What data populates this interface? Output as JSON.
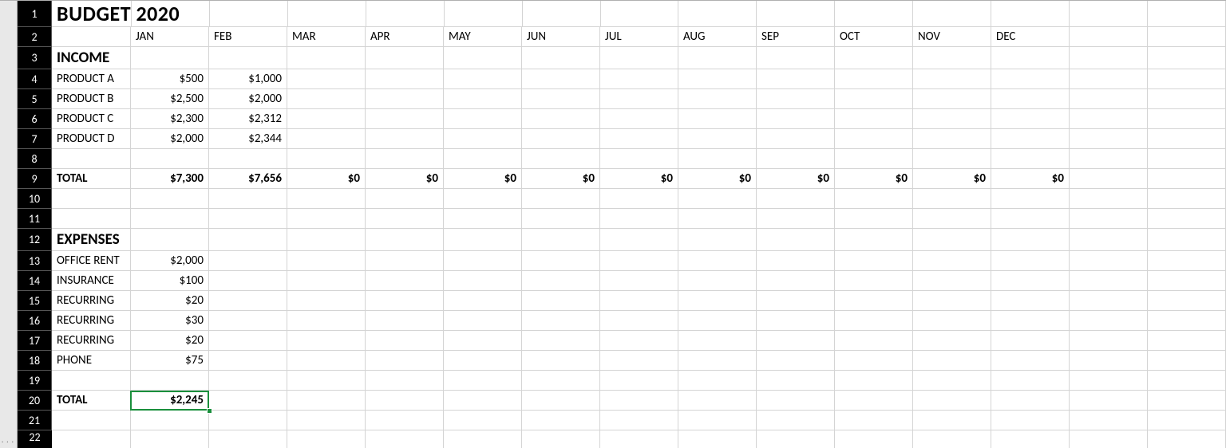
{
  "title": "BUDGET 2020",
  "months": [
    "JAN",
    "FEB",
    "MAR",
    "APR",
    "MAY",
    "JUN",
    "JUL",
    "AUG",
    "SEP",
    "OCT",
    "NOV",
    "DEC"
  ],
  "income": {
    "header": "INCOME",
    "rows": [
      {
        "label": "PRODUCT A",
        "jan": "$500",
        "feb": "$1,000"
      },
      {
        "label": "PRODUCT B",
        "jan": "$2,500",
        "feb": "$2,000"
      },
      {
        "label": "PRODUCT C",
        "jan": "$2,300",
        "feb": "$2,312"
      },
      {
        "label": "PRODUCT D",
        "jan": "$2,000",
        "feb": "$2,344"
      }
    ],
    "total_label": "TOTAL",
    "totals": [
      "$7,300",
      "$7,656",
      "$0",
      "$0",
      "$0",
      "$0",
      "$0",
      "$0",
      "$0",
      "$0",
      "$0",
      "$0"
    ]
  },
  "expenses": {
    "header": "EXPENSES",
    "rows": [
      {
        "label": "OFFICE RENT",
        "jan": "$2,000"
      },
      {
        "label": "INSURANCE",
        "jan": "$100"
      },
      {
        "label": "RECURRING",
        "jan": "$20"
      },
      {
        "label": "RECURRING",
        "jan": "$30"
      },
      {
        "label": "RECURRING",
        "jan": "$20"
      },
      {
        "label": "PHONE",
        "jan": "$75"
      }
    ],
    "total_label": "TOTAL",
    "total_jan": "$2,245"
  },
  "row_numbers": [
    "1",
    "2",
    "3",
    "4",
    "5",
    "6",
    "7",
    "8",
    "9",
    "10",
    "11",
    "12",
    "13",
    "14",
    "15",
    "16",
    "17",
    "18",
    "19",
    "20",
    "21",
    "22"
  ],
  "active_cell": {
    "row": 20,
    "col": "B"
  }
}
